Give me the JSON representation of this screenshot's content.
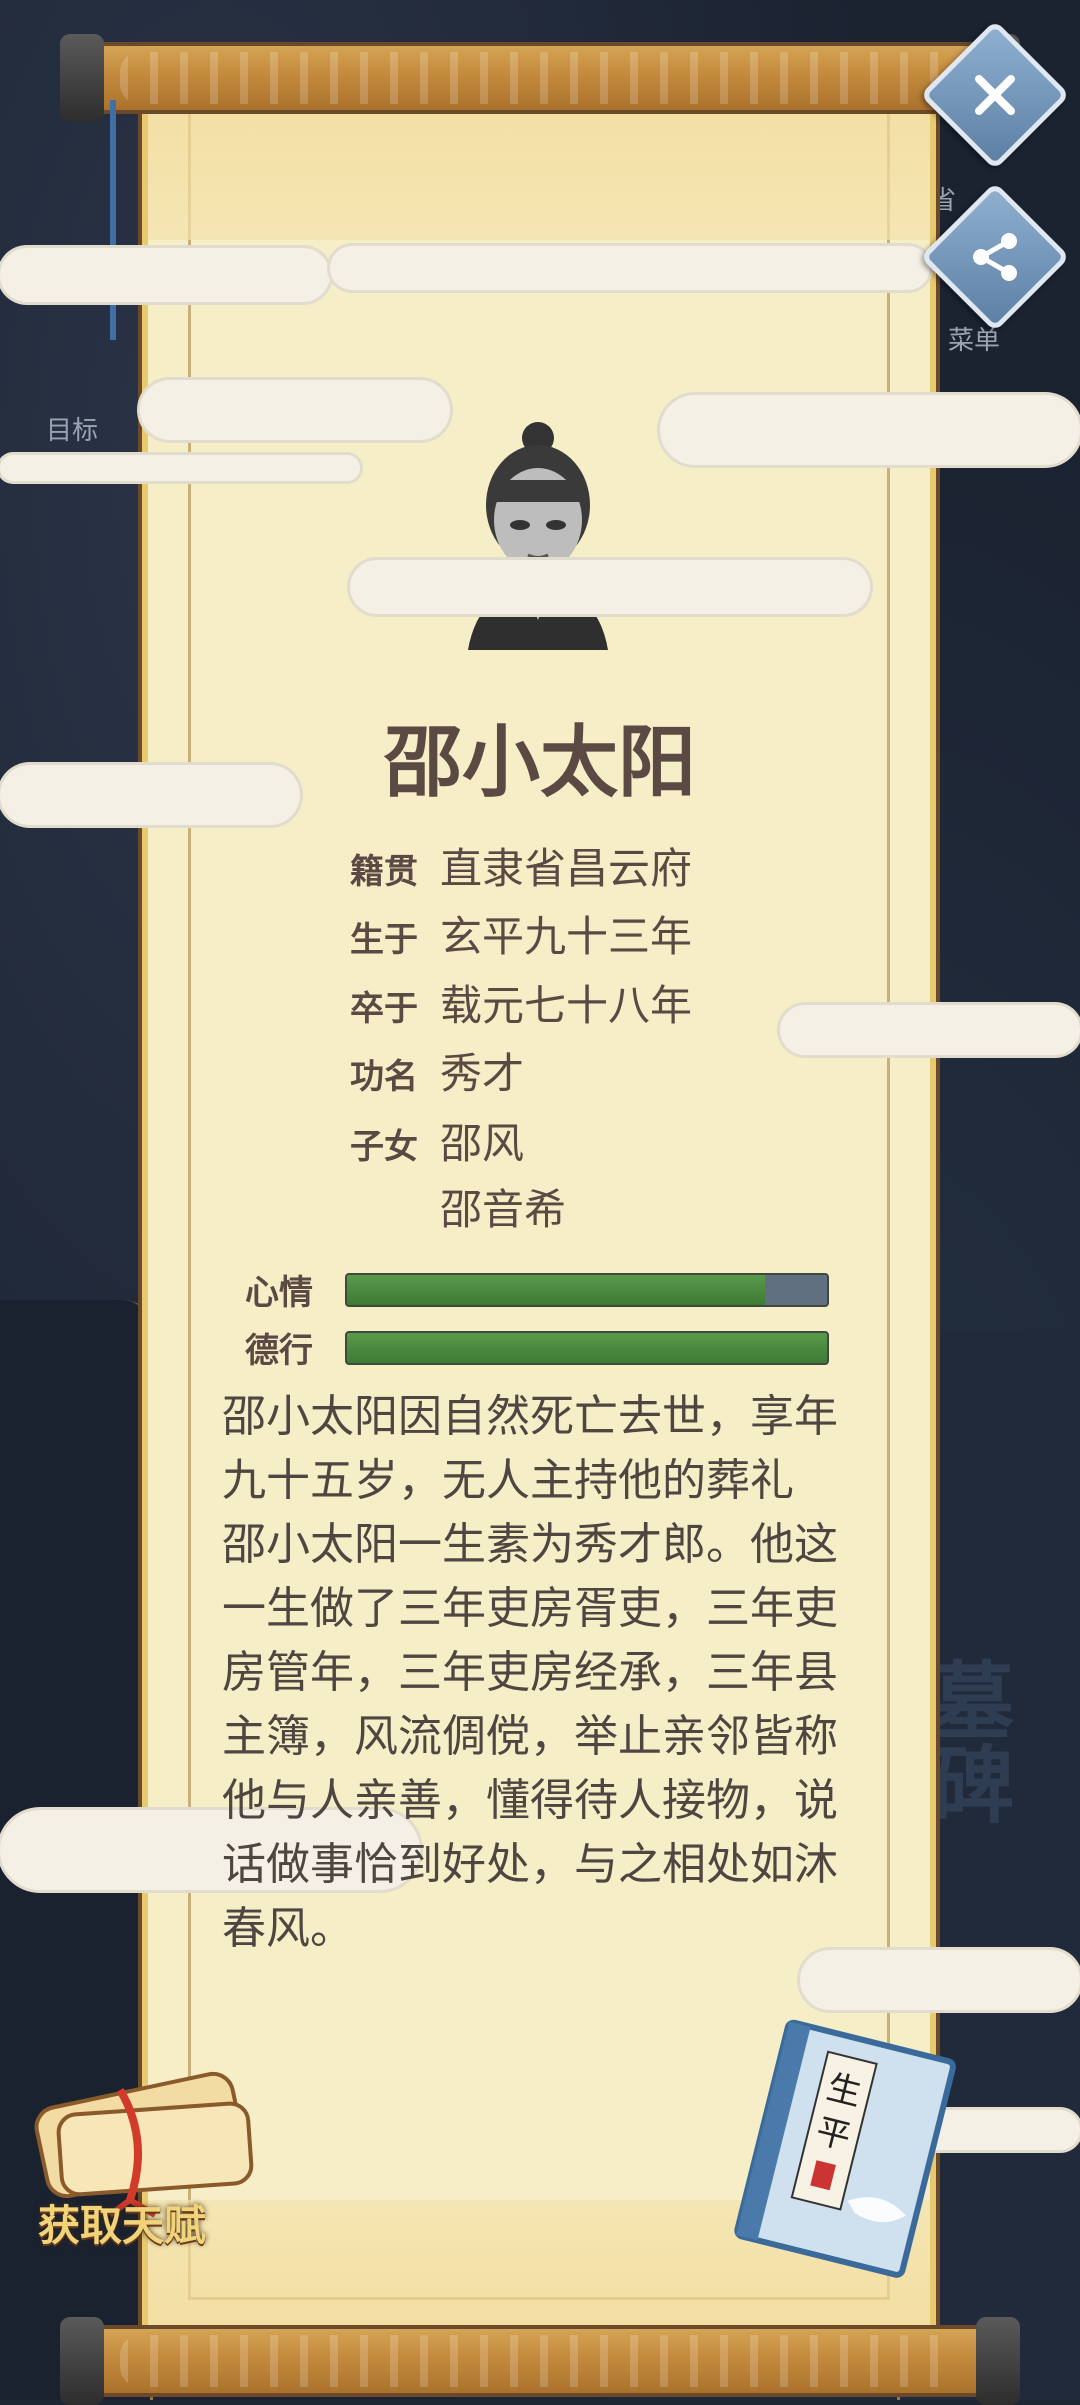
{
  "background": {
    "left_label_1": "目标",
    "right_label_1": "省",
    "right_label_2": "菜单",
    "right_big_text": "墓\n碑"
  },
  "buttons": {
    "close_icon": "close-icon",
    "share_icon": "share-icon"
  },
  "profile": {
    "name": "邵小太阳",
    "rows": [
      {
        "label": "籍贯",
        "value": "直隶省昌云府"
      },
      {
        "label": "生于",
        "value": "玄平九十三年"
      },
      {
        "label": "卒于",
        "value": "载元七十八年"
      },
      {
        "label": "功名",
        "value": "秀才"
      },
      {
        "label": "子女",
        "value": "邵风"
      },
      {
        "label": "",
        "value": "邵音希"
      }
    ],
    "bars": [
      {
        "label": "心情",
        "value": 0.87
      },
      {
        "label": "德行",
        "value": 1.0
      }
    ]
  },
  "bio": {
    "p1": "邵小太阳因自然死亡去世，享年九十五岁，无人主持他的葬礼",
    "p2": "邵小太阳一生素为秀才郎。他这一生做了三年吏房胥吏，三年吏房管年，三年吏房经承，三年县主簿，风流倜傥，举止亲邻皆称他与人亲善，懂得待人接物，说话做事恰到好处，与之相处如沐春风。"
  },
  "talent_button": {
    "label": "获取天赋"
  },
  "book": {
    "label": "生平"
  },
  "colors": {
    "paper": "#f6eec7",
    "text": "#5b4a44",
    "bar_fill": "#4a8a3c",
    "button_blue": "#6f92b8"
  }
}
